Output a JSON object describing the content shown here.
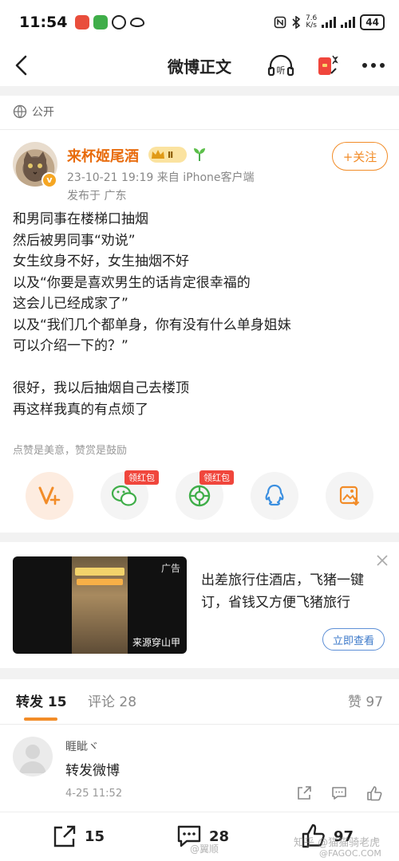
{
  "status_bar": {
    "time": "11:54",
    "net_speed_value": "7.6",
    "net_speed_unit": "K/s",
    "battery": "44"
  },
  "nav": {
    "title": "微博正文"
  },
  "post": {
    "visibility": "公开",
    "author": {
      "name": "来杯姬尾酒",
      "level_badge": "Ⅱ",
      "verified_mark": "v"
    },
    "follow_label": "+关注",
    "meta": "23-10-21 19:19  来自 iPhone客户端",
    "location": "发布于 广东",
    "body_lines": [
      "和男同事在楼梯口抽烟",
      "然后被男同事“劝说”",
      "女生纹身不好，女生抽烟不好",
      "以及“你要是喜欢男生的话肯定很幸福的",
      "这会儿已经成家了”",
      "以及“我们几个都单身，你有没有什么单身姐妹",
      "可以介绍一下的？”",
      "",
      "很好，我以后抽烟自己去楼顶",
      "再这样我真的有点烦了"
    ],
    "reward_note": "点赞是美意，赞赏是鼓励"
  },
  "share": {
    "items": [
      {
        "name": "vplus",
        "icon": "v-plus-icon",
        "tag": ""
      },
      {
        "name": "wechat",
        "icon": "wechat-icon",
        "tag": "领红包"
      },
      {
        "name": "moments",
        "icon": "moments-icon",
        "tag": "领红包"
      },
      {
        "name": "qq",
        "icon": "qq-icon",
        "tag": ""
      },
      {
        "name": "save-image",
        "icon": "save-image-icon",
        "tag": ""
      }
    ]
  },
  "ad": {
    "tag": "广告",
    "source": "来源穿山甲",
    "text": "出差旅行住酒店，飞猪一键订，省钱又方便飞猪旅行",
    "button": "立即查看"
  },
  "tabs": {
    "repost": {
      "label": "转发",
      "count": "15"
    },
    "comment": {
      "label": "评论",
      "count": "28"
    },
    "like": {
      "label": "赞",
      "count": "97"
    }
  },
  "repost_item": {
    "user": "睚眦ヾ",
    "text": "转发微博",
    "time": "4-25 11:52"
  },
  "bottom_bar": {
    "repost_count": "15",
    "comment_count": "28",
    "like_count": "97"
  },
  "watermarks": {
    "weibo": "@翼顺",
    "zhihu": "知乎 @猫猫骑老虎",
    "site": "@FAGOC.COM"
  },
  "colors": {
    "accent_orange": "#f28c28",
    "name_orange": "#e86b0c",
    "link_blue": "#3b78c9",
    "red_tag": "#f0463c"
  }
}
